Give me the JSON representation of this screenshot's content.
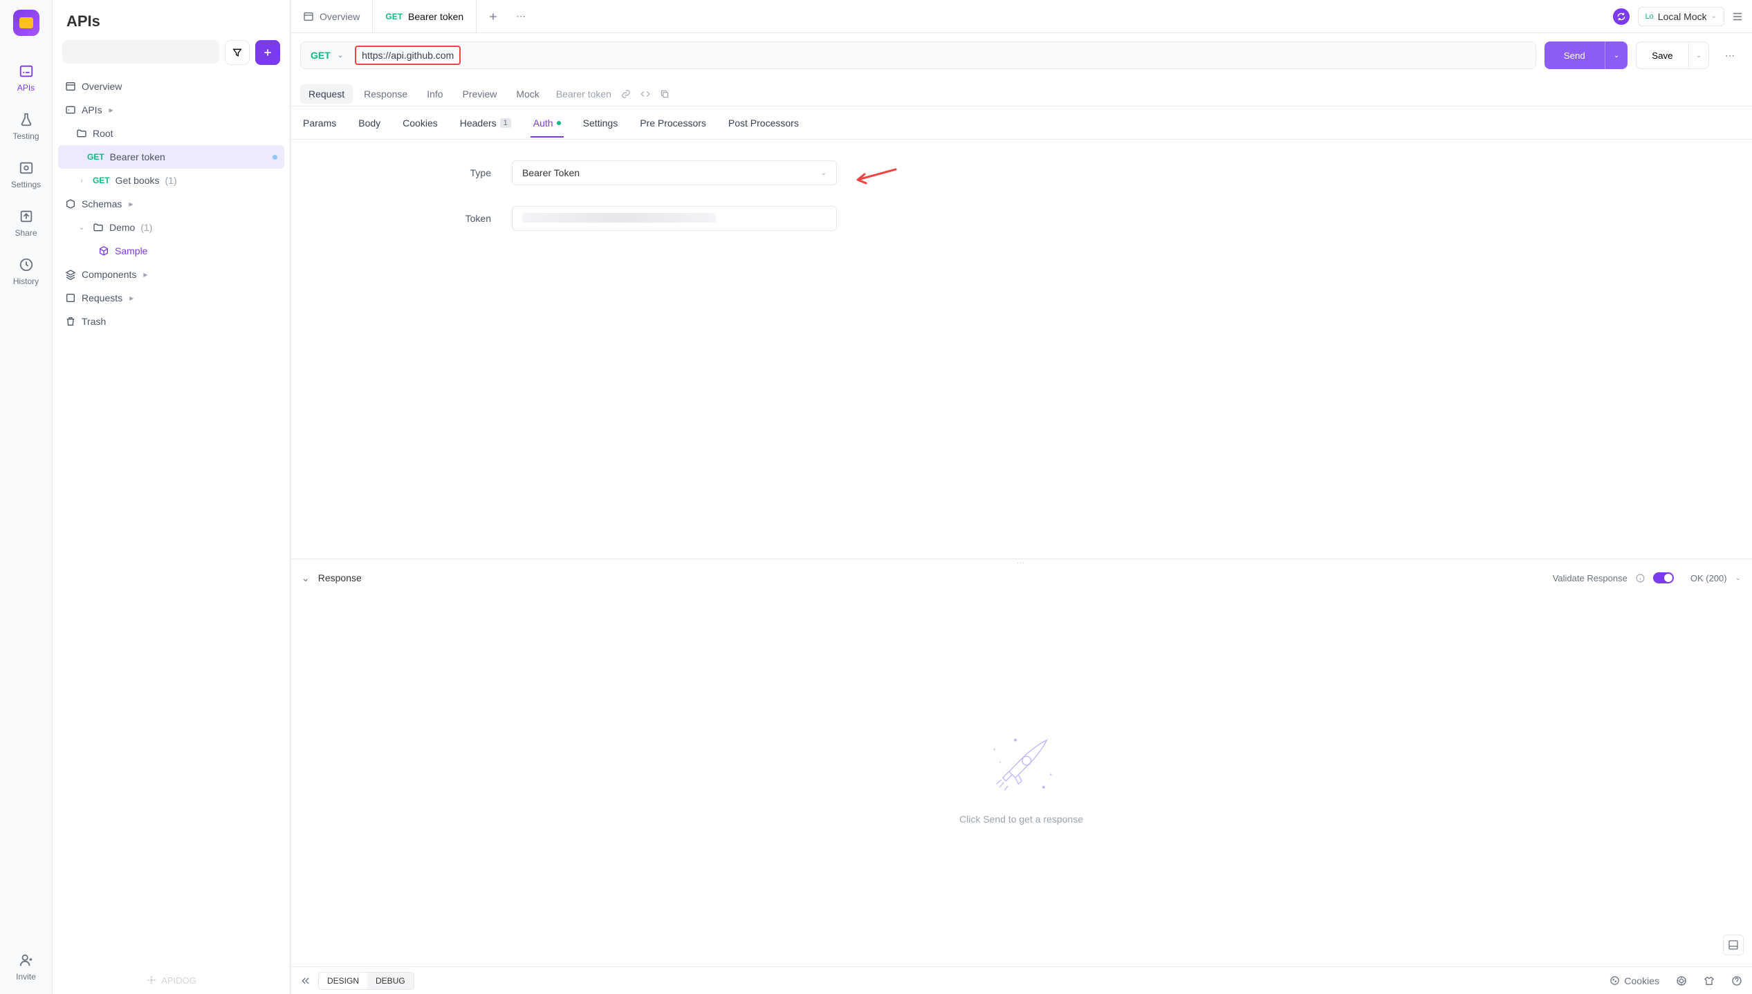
{
  "rail": {
    "items": [
      {
        "label": "APIs",
        "active": true
      },
      {
        "label": "Testing"
      },
      {
        "label": "Settings"
      },
      {
        "label": "Share"
      },
      {
        "label": "History"
      },
      {
        "label": "Invite"
      }
    ]
  },
  "sidebar": {
    "title": "APIs",
    "search_placeholder": "",
    "tree": {
      "overview": "Overview",
      "apis": "APIs",
      "root": "Root",
      "bearer": {
        "method": "GET",
        "name": "Bearer token"
      },
      "getbooks": {
        "method": "GET",
        "name": "Get books",
        "count": "(1)"
      },
      "schemas": "Schemas",
      "demo": {
        "name": "Demo",
        "count": "(1)"
      },
      "sample": "Sample",
      "components": "Components",
      "requests": "Requests",
      "trash": "Trash"
    },
    "footer": "APIDOG"
  },
  "tabs": {
    "overview": "Overview",
    "bearer": {
      "method": "GET",
      "name": "Bearer token"
    }
  },
  "env": {
    "lo": "Lo",
    "name": "Local Mock"
  },
  "url_bar": {
    "method": "GET",
    "url": "https://api.github.com"
  },
  "actions": {
    "send": "Send",
    "save": "Save"
  },
  "subtabs": {
    "request": "Request",
    "response": "Response",
    "info": "Info",
    "preview": "Preview",
    "mock": "Mock",
    "name": "Bearer token"
  },
  "conf_tabs": {
    "params": "Params",
    "body": "Body",
    "cookies": "Cookies",
    "headers": "Headers",
    "headers_count": "1",
    "auth": "Auth",
    "settings": "Settings",
    "pre": "Pre Processors",
    "post": "Post Processors"
  },
  "auth_form": {
    "type_label": "Type",
    "type_value": "Bearer Token",
    "token_label": "Token"
  },
  "response": {
    "title": "Response",
    "validate": "Validate Response",
    "status": "OK (200)",
    "empty": "Click Send to get a response"
  },
  "bottom": {
    "design": "DESIGN",
    "debug": "DEBUG",
    "cookies": "Cookies"
  }
}
